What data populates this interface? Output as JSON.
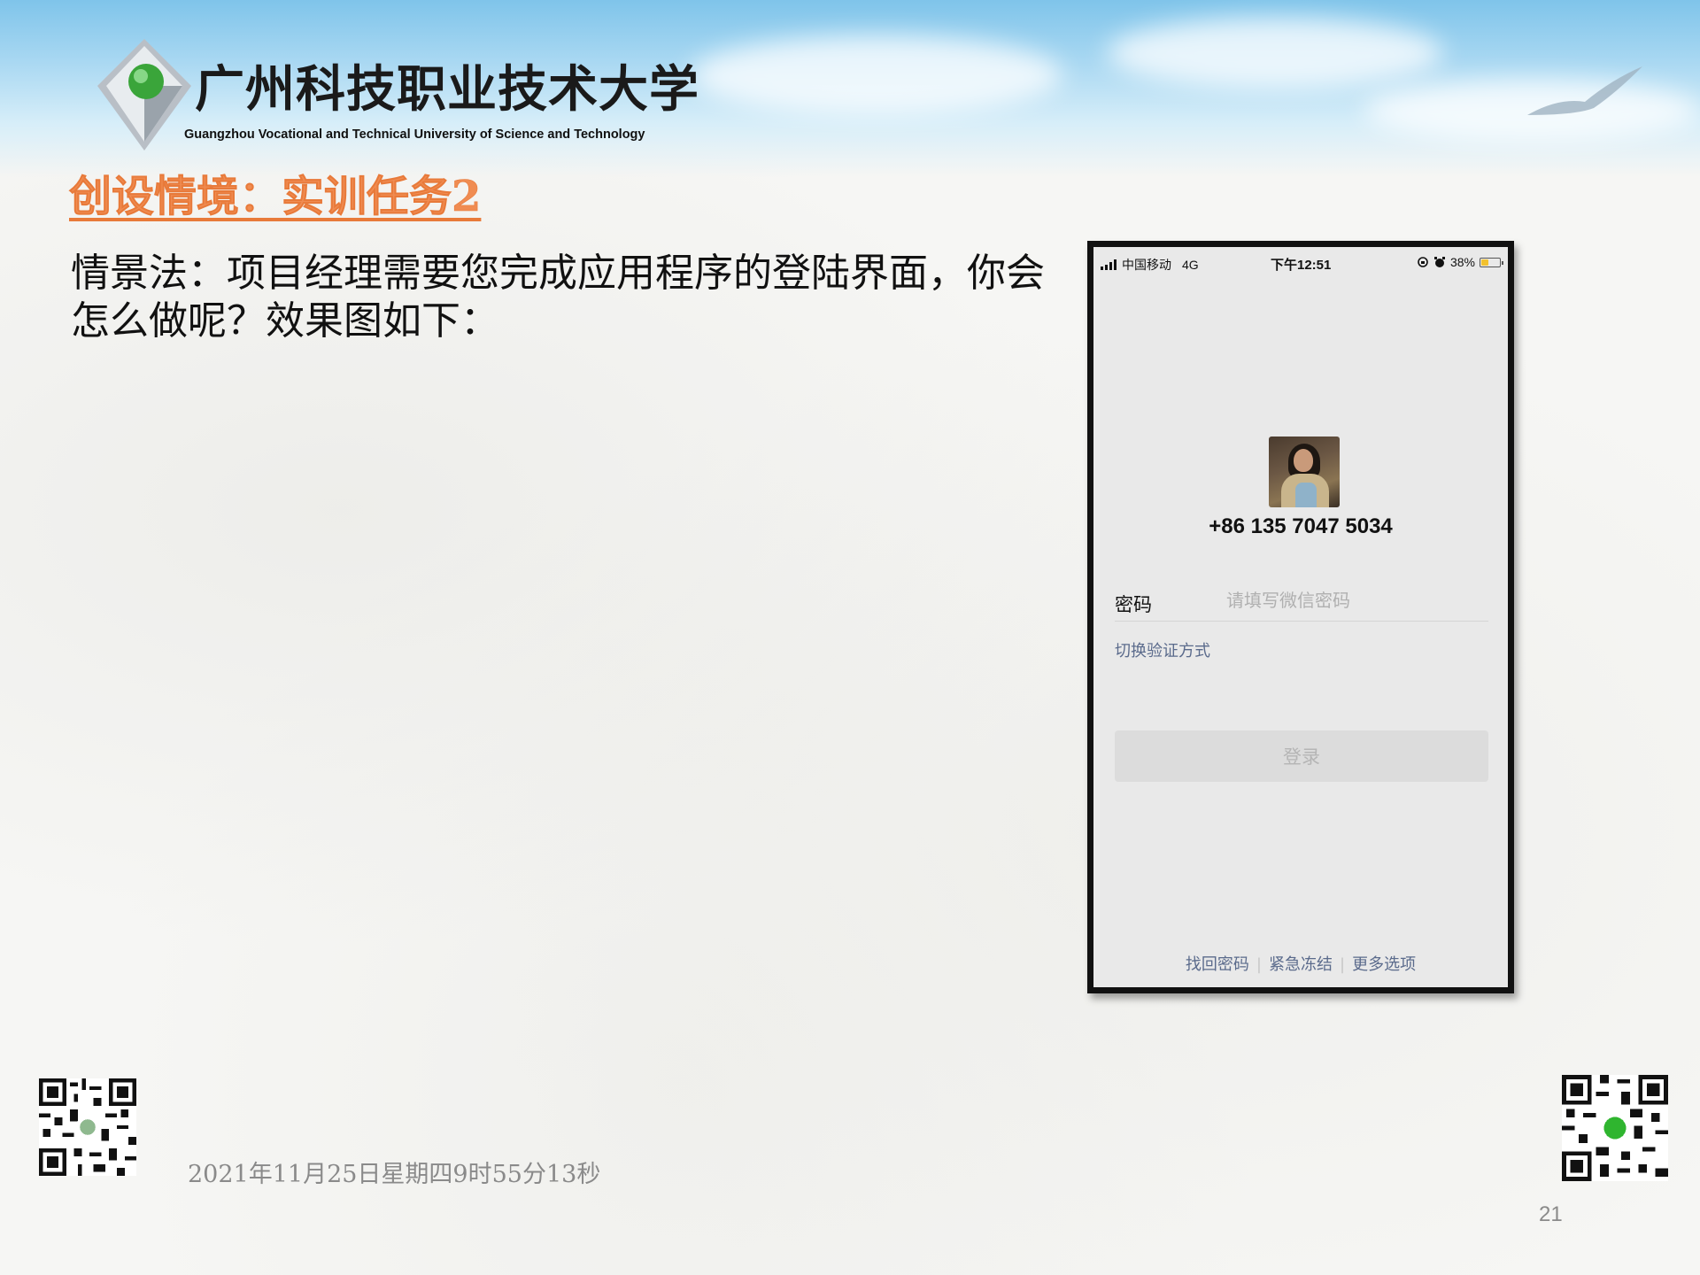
{
  "header": {
    "university_cn": "广州科技职业技术大学",
    "university_en": "Guangzhou Vocational and Technical University of Science and Technology"
  },
  "slide": {
    "title": "创设情境：实训任务2",
    "body": "情景法：项目经理需要您完成应用程序的登陆界面，你会怎么做呢？效果图如下："
  },
  "phone": {
    "status_bar": {
      "carrier": "中国移动",
      "network": "4G",
      "time": "下午12:51",
      "battery": "38%",
      "battery_level": 0.38
    },
    "phone_number": "+86 135 7047 5034",
    "password_label": "密码",
    "password_placeholder": "请填写微信密码",
    "switch_method": "切换验证方式",
    "login_button": "登录",
    "bottom_links": [
      "找回密码",
      "紧急冻结",
      "更多选项"
    ]
  },
  "footer": {
    "datetime": "2021年11月25日星期四9时55分13秒",
    "page_number": "21"
  },
  "colors": {
    "title": "#f08c52",
    "link": "#5b6b8c",
    "banner": "#7fc4ea"
  }
}
